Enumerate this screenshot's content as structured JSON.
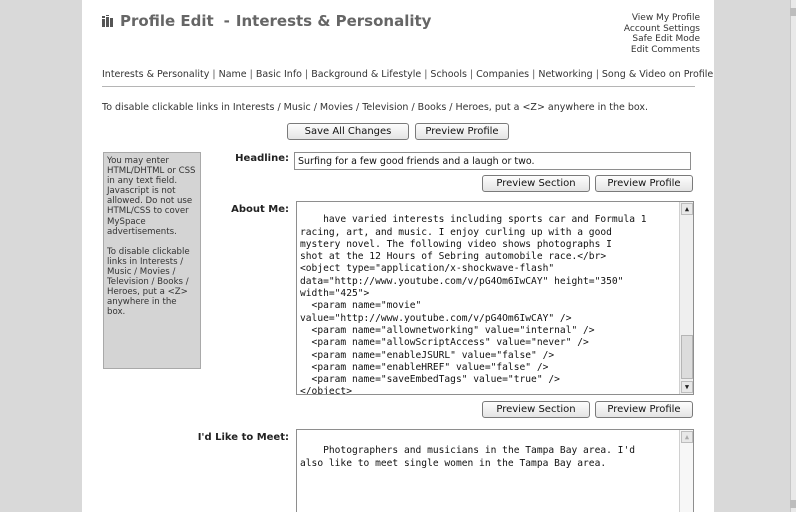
{
  "header": {
    "title_prefix": "Profile Edit",
    "title_separator": "-",
    "title_section": "Interests & Personality",
    "links": [
      "View My Profile",
      "Account Settings",
      "Safe Edit Mode",
      "Edit Comments"
    ]
  },
  "tabs": [
    "Interests & Personality",
    "Name",
    "Basic Info",
    "Background & Lifestyle",
    "Schools",
    "Companies",
    "Networking",
    "Song & Video on Profile"
  ],
  "note": "To disable clickable links in Interests / Music / Movies / Television / Books / Heroes, put a <Z> anywhere in the box.",
  "top_buttons": {
    "save_all": "Save All Changes",
    "preview_profile": "Preview Profile"
  },
  "sidebar": {
    "para1": "You may enter HTML/DHTML or CSS in any text field. Javascript is not allowed. Do not use HTML/CSS to cover MySpace advertisements.",
    "para2": "To disable clickable links in Interests / Music / Movies / Television / Books / Heroes, put a <Z> anywhere in the box."
  },
  "fields": {
    "headline": {
      "label": "Headline:",
      "value": "Surfing for a few good friends and a laugh or two."
    },
    "about_me": {
      "label": "About Me:",
      "value": "have varied interests including sports car and Formula 1\nracing, art, and music. I enjoy curling up with a good\nmystery novel. The following video shows photographs I\nshot at the 12 Hours of Sebring automobile race.</br>\n<object type=\"application/x-shockwave-flash\"\ndata=\"http://www.youtube.com/v/pG4Om6IwCAY\" height=\"350\"\nwidth=\"425\">\n  <param name=\"movie\"\nvalue=\"http://www.youtube.com/v/pG4Om6IwCAY\" />\n  <param name=\"allownetworking\" value=\"internal\" />\n  <param name=\"allowScriptAccess\" value=\"never\" />\n  <param name=\"enableJSURL\" value=\"false\" />\n  <param name=\"enableHREF\" value=\"false\" />\n  <param name=\"saveEmbedTags\" value=\"true\" />\n</object>"
    },
    "like_to_meet": {
      "label": "I'd Like to Meet:",
      "value": "Photographers and musicians in the Tampa Bay area. I'd\nalso like to meet single women in the Tampa Bay area."
    }
  },
  "section_buttons": {
    "preview_section": "Preview Section",
    "preview_profile": "Preview Profile"
  }
}
